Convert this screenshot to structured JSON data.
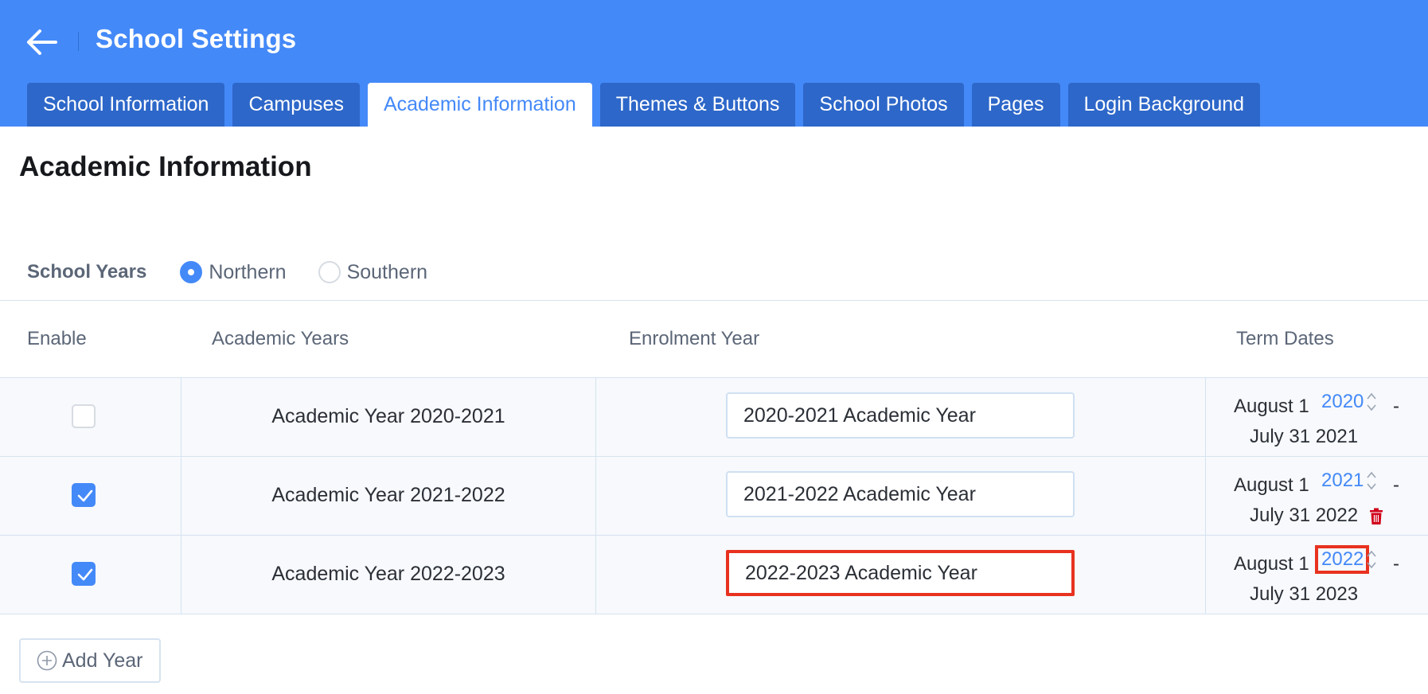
{
  "header": {
    "title": "School Settings",
    "tabs": [
      {
        "label": "School Information",
        "active": false
      },
      {
        "label": "Campuses",
        "active": false
      },
      {
        "label": "Academic Information",
        "active": true
      },
      {
        "label": "Themes & Buttons",
        "active": false
      },
      {
        "label": "School Photos",
        "active": false
      },
      {
        "label": "Pages",
        "active": false
      },
      {
        "label": "Login Background",
        "active": false
      }
    ]
  },
  "section_title": "Academic Information",
  "school_years": {
    "label": "School Years",
    "options": [
      {
        "label": "Northern",
        "selected": true
      },
      {
        "label": "Southern",
        "selected": false
      }
    ]
  },
  "table": {
    "headers": {
      "enable": "Enable",
      "academic_years": "Academic Years",
      "enrolment_year": "Enrolment Year",
      "term_dates": "Term Dates"
    },
    "rows": [
      {
        "enabled": false,
        "academic_year": "Academic Year 2020-2021",
        "enrolment_year": "2020-2021 Academic Year",
        "term_start": "August 1",
        "start_year": "2020",
        "dash": "-",
        "term_end": "July 31 2021",
        "deletable": false
      },
      {
        "enabled": true,
        "academic_year": "Academic Year 2021-2022",
        "enrolment_year": "2021-2022 Academic Year",
        "term_start": "August 1",
        "start_year": "2021",
        "dash": "-",
        "term_end": "July 31 2022",
        "deletable": true
      },
      {
        "enabled": true,
        "academic_year": "Academic Year 2022-2023",
        "enrolment_year": "2022-2023 Academic Year",
        "term_start": "August 1",
        "start_year": "2022",
        "dash": "-",
        "term_end": "July 31 2023",
        "deletable": false
      }
    ]
  },
  "add_year_label": "Add Year",
  "colors": {
    "header_bg": "#4489f8",
    "tab_bg": "#2d67c9",
    "accent": "#4489f8",
    "highlight": "#e8321f",
    "trash": "#d0021b"
  },
  "icons": {
    "back": "arrow-left-icon",
    "check": "checkmark-icon",
    "spinner": "chevron-up-down-icon",
    "trash": "trash-icon",
    "add": "plus-circle-icon"
  }
}
